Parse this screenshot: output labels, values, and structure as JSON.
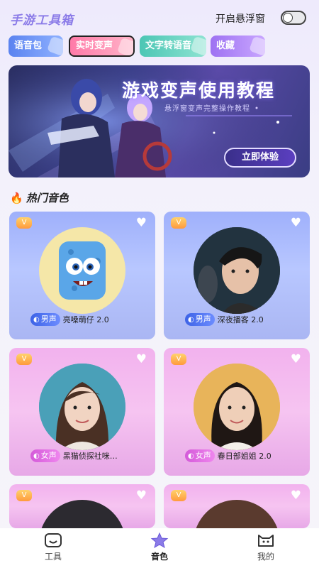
{
  "header": {
    "app_title": "手游工具箱",
    "float_window_label": "开启悬浮窗",
    "float_window_enabled": false
  },
  "chips": [
    {
      "label": "语音包"
    },
    {
      "label": "实时变声"
    },
    {
      "label": "文字转语音"
    },
    {
      "label": "收藏"
    }
  ],
  "banner": {
    "title": "游戏变声使用教程",
    "subtitle": "悬浮窗变声完整操作教程",
    "button_label": "立即体验"
  },
  "section": {
    "title": "热门音色"
  },
  "cards": [
    {
      "gender": "男声",
      "name": "亮嗓萌仔 2.0"
    },
    {
      "gender": "男声",
      "name": "深夜播客 2.0"
    },
    {
      "gender": "女声",
      "name": "黑猫侦探社咪…"
    },
    {
      "gender": "女声",
      "name": "春日部姐姐 2.0"
    }
  ],
  "nav": [
    {
      "label": "工具"
    },
    {
      "label": "音色"
    },
    {
      "label": "我的"
    }
  ],
  "colors": {
    "accent": "#8b7be8",
    "male_badge": "#3d63e6",
    "female_badge": "#d45ad9"
  }
}
